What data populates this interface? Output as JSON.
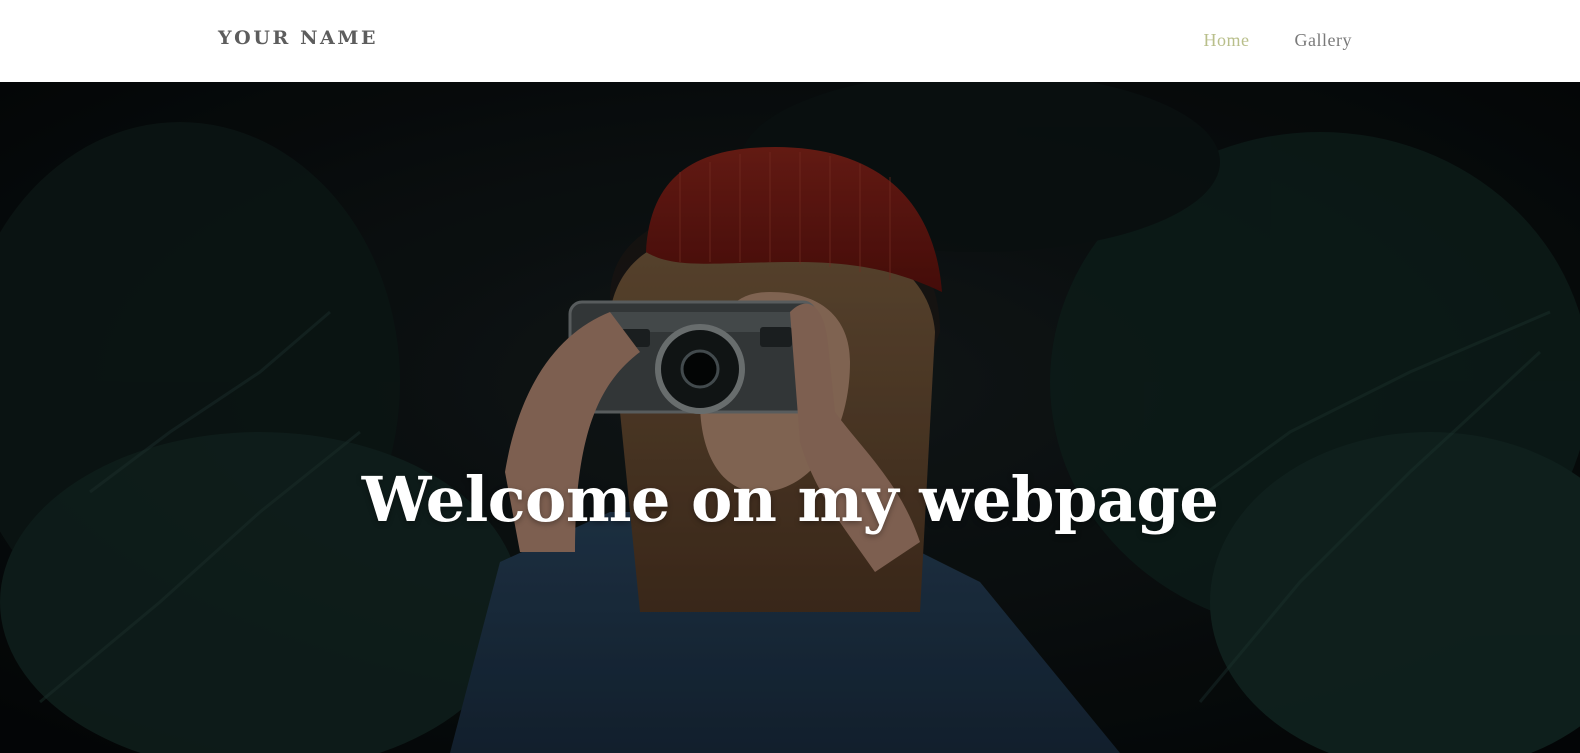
{
  "header": {
    "brand": "YOUR NAME",
    "nav": [
      {
        "label": "Home",
        "active": true
      },
      {
        "label": "Gallery",
        "active": false
      }
    ],
    "colors": {
      "background": "#ffffff",
      "brand_text": "#5d5d5d",
      "active_link": "#b9bf8b",
      "inactive_link": "#7a7a7a"
    }
  },
  "hero": {
    "title": "Welcome on my webpage",
    "image_description_icon": "photographer-with-camera-image",
    "colors": {
      "title": "#ffffff",
      "hat": "#8e1d16",
      "foliage": "#16302c"
    }
  }
}
